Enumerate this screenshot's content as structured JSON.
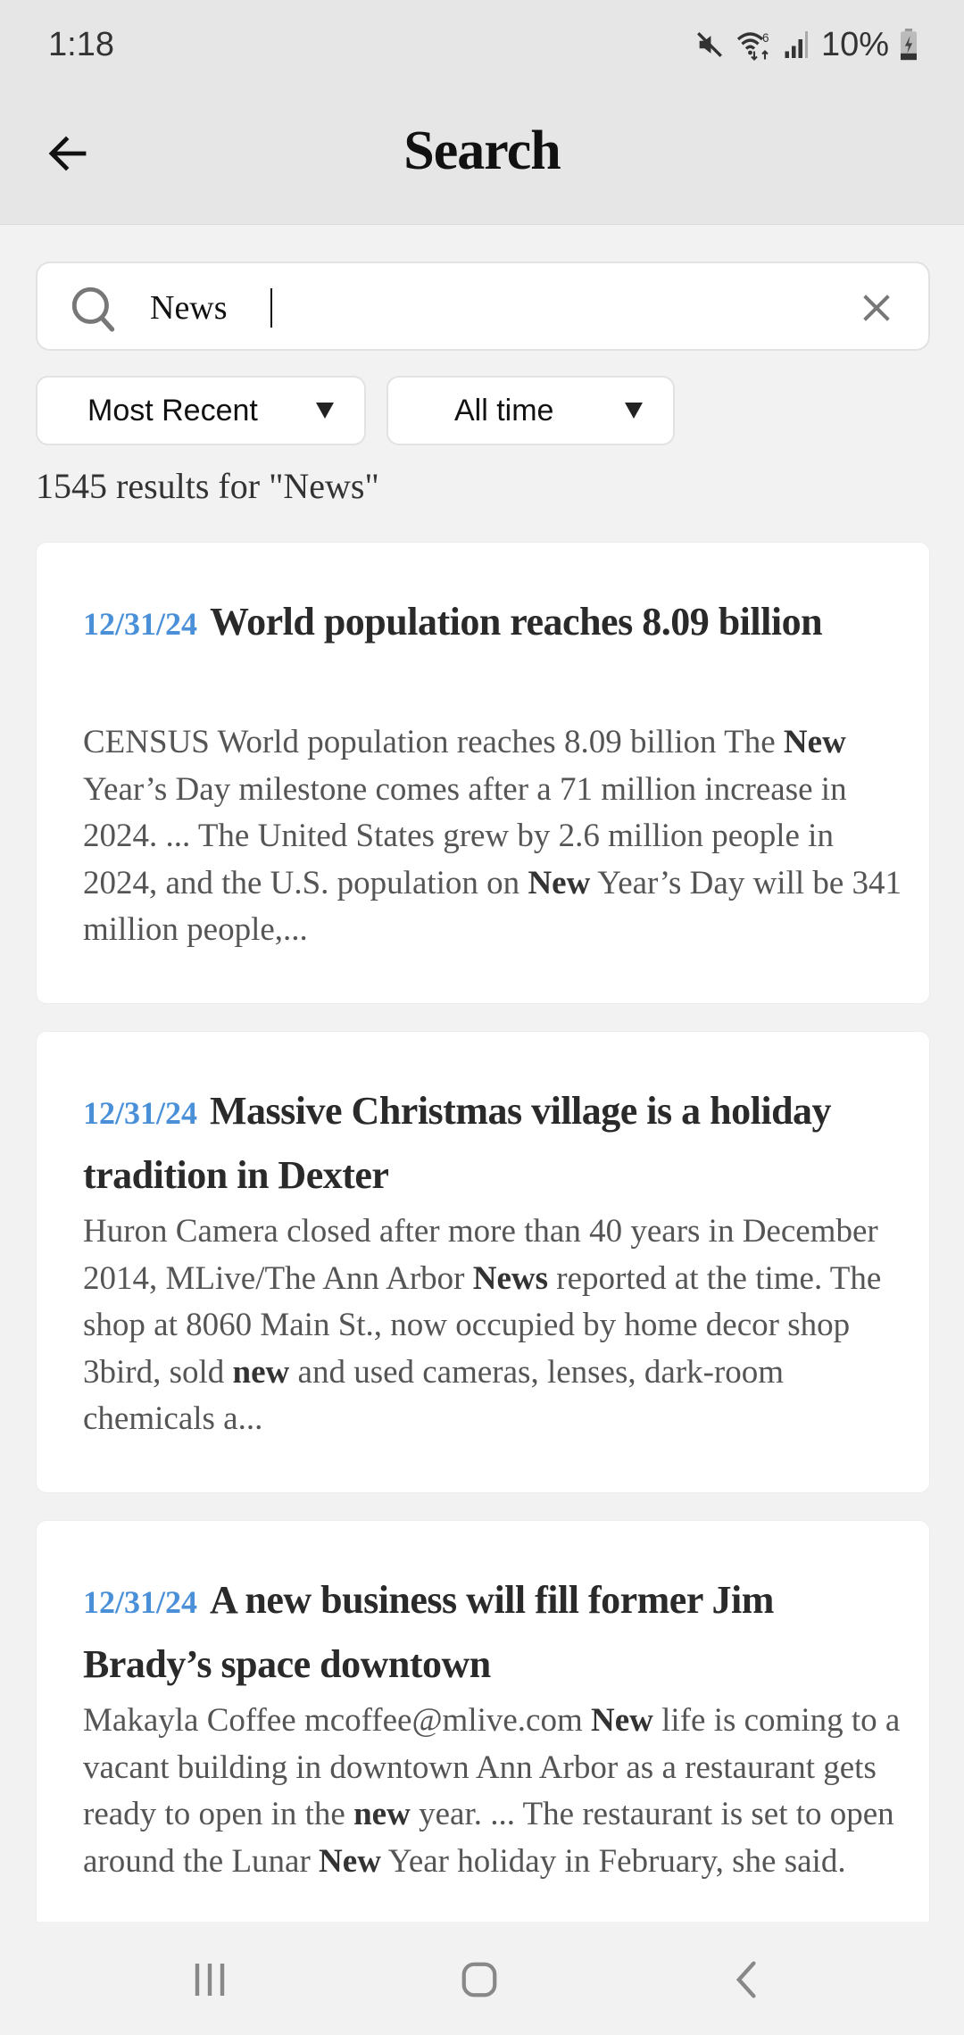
{
  "status_bar": {
    "time": "1:18",
    "battery_percent": "10%",
    "icons": [
      "mute-icon",
      "wifi-6-icon",
      "signal-icon",
      "battery-charging-icon"
    ]
  },
  "app_bar": {
    "title": "Search",
    "back_icon": "arrow-left-icon"
  },
  "search": {
    "value": "News",
    "icon": "search-icon",
    "clear_icon": "close-icon"
  },
  "filters": {
    "sort": {
      "selected": "Most Recent"
    },
    "time_range": {
      "selected": "All time"
    }
  },
  "results": {
    "summary": "1545 results for \"News\"",
    "items": [
      {
        "date": "12/31/24",
        "title": "World population reaches 8.09 billion",
        "snippet_parts": [
          {
            "t": "CENSUS World population reaches 8.09 billion The ",
            "b": false
          },
          {
            "t": "New",
            "b": true
          },
          {
            "t": " Year’s Day milestone comes after a 71 million increase in 2024. ... The United States grew by 2.6 million people in 2024, and the U.S. population on ",
            "b": false
          },
          {
            "t": "New",
            "b": true
          },
          {
            "t": " Year’s Day will be 341 million people,...",
            "b": false
          }
        ]
      },
      {
        "date": "12/31/24",
        "title": "Massive Christmas village is a holiday tradition in Dexter",
        "snippet_parts": [
          {
            "t": "Huron Camera closed after more than 40 years in December 2014, MLive/The Ann Arbor ",
            "b": false
          },
          {
            "t": "News",
            "b": true
          },
          {
            "t": " reported at the time. The shop at 8060 Main St., now occupied by home decor shop 3bird, sold ",
            "b": false
          },
          {
            "t": "new",
            "b": true
          },
          {
            "t": " and used cameras, lenses, dark-room chemicals a...",
            "b": false
          }
        ]
      },
      {
        "date": "12/31/24",
        "title": "A new business will fill former Jim Brady’s space downtown",
        "snippet_parts": [
          {
            "t": "Makayla Coffee mcoffee@mlive.com ",
            "b": false
          },
          {
            "t": "New",
            "b": true
          },
          {
            "t": " life is coming to a vacant building in downtown Ann Arbor as a restaurant gets ready to open in the ",
            "b": false
          },
          {
            "t": "new",
            "b": true
          },
          {
            "t": " year. ... The restaurant is set to open around the Lunar ",
            "b": false
          },
          {
            "t": "New",
            "b": true
          },
          {
            "t": " Year holiday in February, she said.",
            "b": false
          }
        ]
      }
    ]
  },
  "nav_bar": {
    "buttons": [
      "recents-icon",
      "home-icon",
      "back-icon"
    ]
  },
  "colors": {
    "accent_date": "#4a90d9",
    "app_bar_bg": "#e6e6e6",
    "page_bg": "#f2f2f2"
  }
}
